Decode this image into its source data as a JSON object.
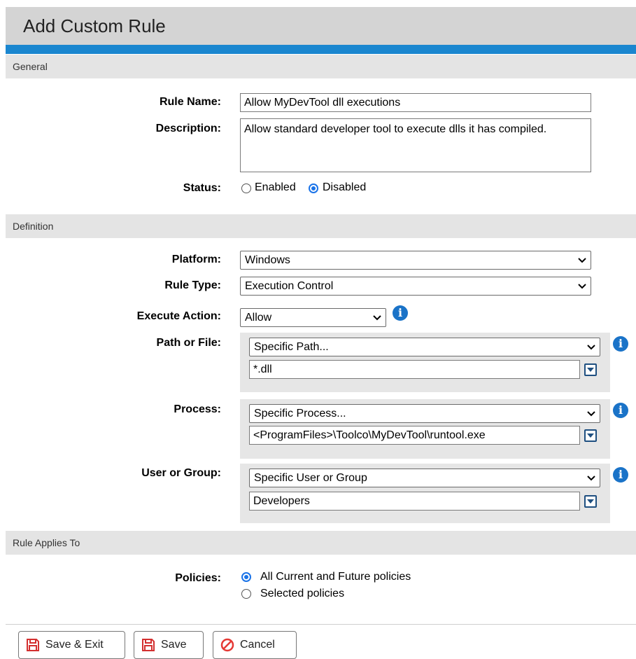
{
  "header": {
    "title": "Add Custom Rule"
  },
  "sections": {
    "general": "General",
    "definition": "Definition",
    "applies": "Rule Applies To"
  },
  "general": {
    "rule_name_label": "Rule Name:",
    "rule_name_value": "Allow MyDevTool dll executions",
    "description_label": "Description:",
    "description_value": "Allow standard developer tool to execute dlls it has compiled.",
    "status_label": "Status:",
    "status_options": [
      "Enabled",
      "Disabled"
    ],
    "status_selected": "Disabled"
  },
  "definition": {
    "platform_label": "Platform:",
    "platform_value": "Windows",
    "rule_type_label": "Rule Type:",
    "rule_type_value": "Execution Control",
    "execute_action_label": "Execute Action:",
    "execute_action_value": "Allow",
    "path_label": "Path or File:",
    "path_select": "Specific Path...",
    "path_value": "*.dll",
    "process_label": "Process:",
    "process_select": "Specific Process...",
    "process_value": "<ProgramFiles>\\Toolco\\MyDevTool\\runtool.exe",
    "user_label": "User or Group:",
    "user_select": "Specific User or Group",
    "user_value": "Developers"
  },
  "applies": {
    "policies_label": "Policies:",
    "options": [
      "All Current and Future policies",
      "Selected policies"
    ],
    "selected": "All Current and Future policies"
  },
  "buttons": {
    "save_exit": "Save & Exit",
    "save": "Save",
    "cancel": "Cancel"
  },
  "colors": {
    "accent": "#1a86cf",
    "info_icon": "#1a73c8",
    "cancel_icon": "#e53935",
    "save_icon": "#d32f2f"
  }
}
